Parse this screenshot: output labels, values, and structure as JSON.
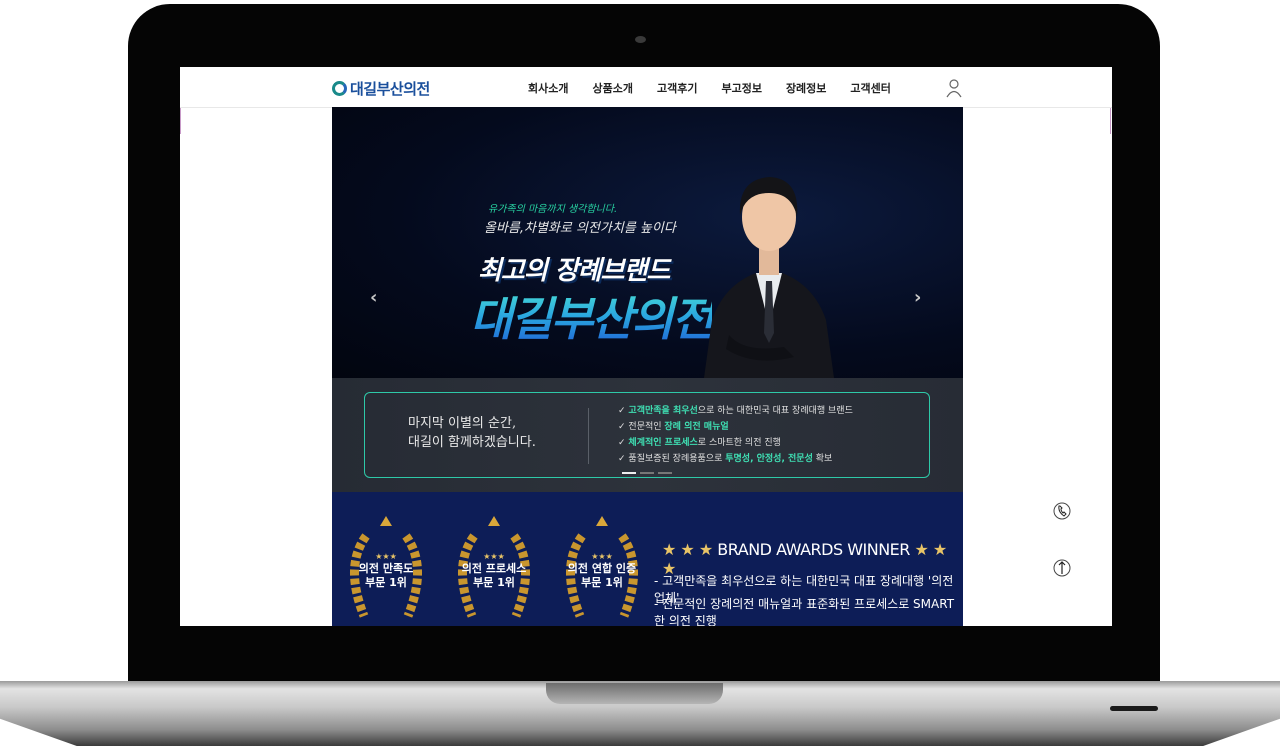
{
  "header": {
    "logo_text": "대길부산의전",
    "nav": [
      "회사소개",
      "상품소개",
      "고객후기",
      "부고정보",
      "장례정보",
      "고객센터"
    ],
    "user_icon": "user-icon"
  },
  "hero": {
    "subtitle_1": "유가족의 마음까지 생각합니다.",
    "subtitle_2": "올바름,차별화로 의전가치를 높이다",
    "headline_1": "최고의 장례브랜드",
    "headline_2": "대길부산의전",
    "prev_icon": "chevron-left-icon",
    "next_icon": "chevron-right-icon"
  },
  "band": {
    "left_line_1": "마지막 이별의 순간,",
    "left_line_2": "대길이 함께하겠습니다.",
    "items": [
      {
        "check": "✓",
        "hl": "고객만족을 최우선",
        "rest": "으로 하는 대한민국 대표 장례대행 브랜드"
      },
      {
        "check": "✓",
        "pre": "전문적인 ",
        "hl": "장례 의전 매뉴얼",
        "rest": ""
      },
      {
        "check": "✓",
        "hl": "체계적인 프로세스",
        "rest": "로 스마트한 의전 진행"
      },
      {
        "check": "✓",
        "pre": "품질보증된 장례용품으로 ",
        "hl": "투명성, 안정성, 전문성",
        "rest": " 확보"
      }
    ],
    "active_slide": 1,
    "slide_count": 3
  },
  "awards": {
    "badges": [
      {
        "stars": "★★★",
        "line1": "의전 만족도",
        "line2": "부문 1위"
      },
      {
        "stars": "★★★",
        "line1": "의전 프로세스",
        "line2": "부문 1위"
      },
      {
        "stars": "★★★",
        "line1": "의전 연합 인증",
        "line2": "부문 1위"
      }
    ],
    "title_stars": "★ ★ ★",
    "title": "BRAND AWARDS WINNER",
    "line_1": "- 고객만족을 최우선으로 하는 대한민국 대표 장례대행 '의전업체'",
    "line_2": "- 전문적인 장례의전 매뉴얼과 표준화된 프로세스로 SMART한 의전 진행"
  },
  "side": {
    "phone_icon": "phone-icon",
    "top_icon": "arrow-up-icon"
  },
  "colors": {
    "brand": "#1a4f9c",
    "accent": "#2ec9a8",
    "awards_bg": "#0d1d57",
    "gold": "#e8c467"
  }
}
